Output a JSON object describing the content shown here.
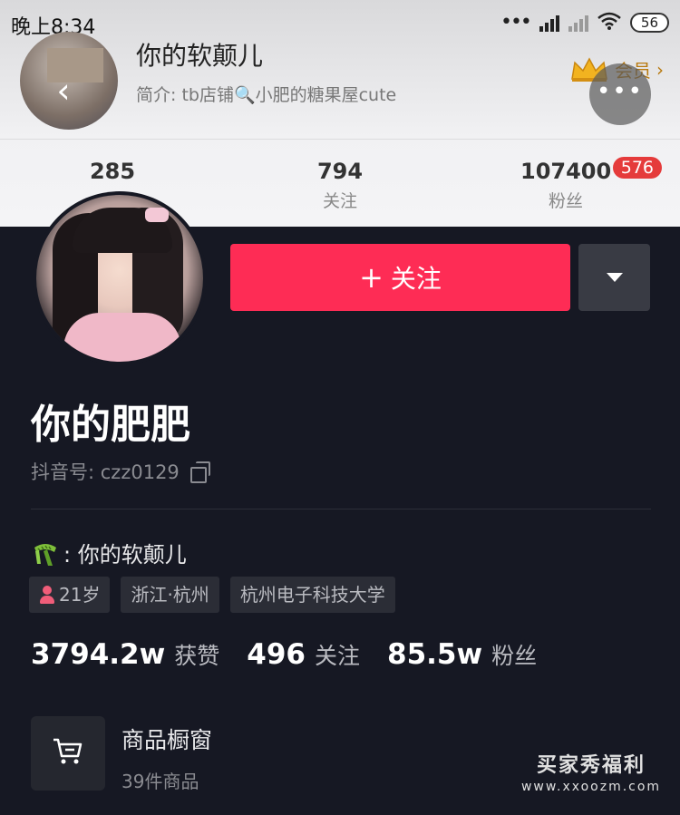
{
  "status_bar": {
    "time": "晚上8:34",
    "battery": "56"
  },
  "header": {
    "name": "你的软颠儿",
    "bio": "简介: tb店铺🔍小肥的糖果屋cute",
    "vip_label": "会员",
    "counts": [
      {
        "num": "285",
        "label": ""
      },
      {
        "num": "794",
        "label": "关注"
      },
      {
        "num": "107400",
        "label": "粉丝",
        "badge": "576"
      }
    ]
  },
  "profile": {
    "follow_label": "关注",
    "name": "你的肥肥",
    "douyin_id": "抖音号: czz0129",
    "bio": ": 你的软颠儿",
    "tags": [
      "21岁",
      "浙江·杭州",
      "杭州电子科技大学"
    ],
    "stats": [
      {
        "num": "3794.2w",
        "label": "获赞"
      },
      {
        "num": "496",
        "label": "关注"
      },
      {
        "num": "85.5w",
        "label": "粉丝"
      }
    ],
    "shop_title": "商品橱窗",
    "shop_sub": "39件商品"
  },
  "watermark": {
    "line1": "买家秀福利",
    "line2": "www.xxoozm.com"
  },
  "colors": {
    "accent": "#fe2c55",
    "background": "#161823",
    "badge": "#e53b3b"
  }
}
